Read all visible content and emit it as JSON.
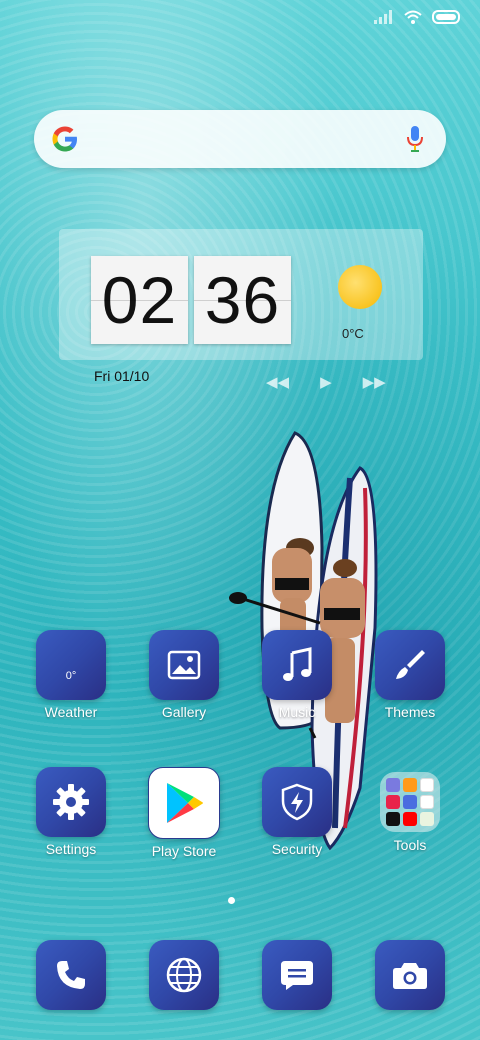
{
  "status_bar": {
    "icons": [
      "signal-icon",
      "wifi-icon",
      "battery-icon"
    ]
  },
  "search": {
    "logo": "google-logo",
    "mic_icon": "mic-icon"
  },
  "clock": {
    "hours": "02",
    "minutes": "36",
    "weather_icon": "sun-icon",
    "temperature": "0°C",
    "date": "Fri 01/10"
  },
  "media_controls": {
    "prev": "◀◀",
    "play": "▶",
    "next": "▶▶"
  },
  "home_apps": [
    {
      "label": "Weather",
      "icon": "weather-icon",
      "badge": "0°"
    },
    {
      "label": "Gallery",
      "icon": "gallery-icon"
    },
    {
      "label": "Music",
      "icon": "music-icon"
    },
    {
      "label": "Themes",
      "icon": "paintbrush-icon"
    },
    {
      "label": "Settings",
      "icon": "gear-icon"
    },
    {
      "label": "Play Store",
      "icon": "play-store-icon"
    },
    {
      "label": "Security",
      "icon": "shield-icon"
    },
    {
      "label": "Tools",
      "icon": "folder-icon"
    }
  ],
  "page_indicator": {
    "pages": 1,
    "current": 1
  },
  "dock": [
    {
      "icon": "phone-icon"
    },
    {
      "icon": "browser-icon"
    },
    {
      "icon": "messages-icon"
    },
    {
      "icon": "camera-icon"
    }
  ],
  "colors": {
    "icon_bg_start": "#3a5bc0",
    "icon_bg_end": "#2a2f85",
    "sun": "#f6b800"
  }
}
